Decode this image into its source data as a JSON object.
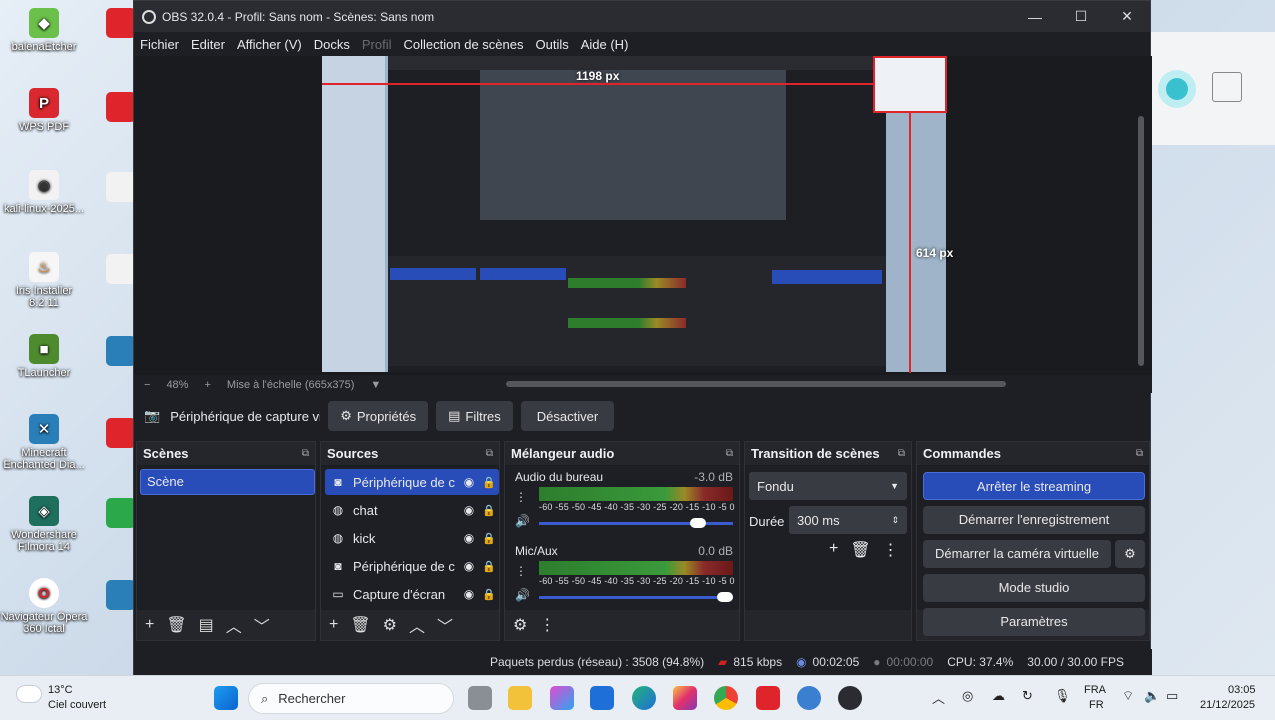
{
  "window": {
    "title": "OBS 32.0.4 - Profil: Sans nom - Scènes: Sans nom"
  },
  "menu": [
    "Fichier",
    "Editer",
    "Afficher (V)",
    "Docks",
    "Profil",
    "Collection de scènes",
    "Outils",
    "Aide (H)"
  ],
  "preview": {
    "width_label": "1198 px",
    "height_label": "614 px",
    "zoom": "48%",
    "scale_mode": "Mise à l'échelle (665x375)"
  },
  "source_toolbar": {
    "selected_source": "Périphérique de capture vid",
    "properties": "Propriétés",
    "filters": "Filtres",
    "deactivate": "Désactiver"
  },
  "scenes": {
    "title": "Scènes",
    "items": [
      "Scène"
    ]
  },
  "sources": {
    "title": "Sources",
    "items": [
      {
        "name": "Périphérique de c",
        "icon": "camera-icon"
      },
      {
        "name": "chat",
        "icon": "browser-icon"
      },
      {
        "name": "kick",
        "icon": "browser-icon"
      },
      {
        "name": "Périphérique de c",
        "icon": "camera-icon"
      },
      {
        "name": "Capture d'écran",
        "icon": "display-icon"
      }
    ]
  },
  "mixer": {
    "title": "Mélangeur audio",
    "channels": [
      {
        "name": "Audio du bureau",
        "db": "-3.0 dB",
        "level": 0.85
      },
      {
        "name": "Mic/Aux",
        "db": "0.0 dB",
        "level": 1.0
      }
    ],
    "scale": "-60 -55 -50 -45 -40 -35 -30 -25 -20 -15 -10 -5 0"
  },
  "transitions": {
    "title": "Transition de scènes",
    "type": "Fondu",
    "duration_label": "Durée",
    "duration": "300 ms"
  },
  "commands": {
    "title": "Commandes",
    "buttons": [
      "Arrêter le streaming",
      "Démarrer l'enregistrement",
      "Démarrer la caméra virtuelle",
      "Mode studio",
      "Paramètres"
    ]
  },
  "status": {
    "dropped": "Paquets perdus (réseau) : 3508 (94.8%)",
    "bitrate": "815 kbps",
    "stream_time": "00:02:05",
    "rec_time": "00:00:00",
    "cpu": "CPU: 37.4%",
    "fps": "30.00 / 30.00 FPS"
  },
  "desktop_icons": [
    "balenaEtcher",
    "WPS PDF",
    "kali-linux-2025...",
    "Iris Installer 8.2.11",
    "TLauncher",
    "Minecraft Enchanted Dia...",
    "Wondershare Filmora 14",
    "Navigateur Opera 360 Ictal"
  ],
  "taskbar": {
    "weather_temp": "13°C",
    "weather_desc": "Ciel couvert",
    "search": "Rechercher",
    "lang1": "FRA",
    "lang2": "FR",
    "time": "03:05",
    "date": "21/12/2025"
  },
  "colors": {
    "accent": "#284cb8",
    "bg": "#1e1f24",
    "panel": "#25262c",
    "red": "#e0242b"
  }
}
